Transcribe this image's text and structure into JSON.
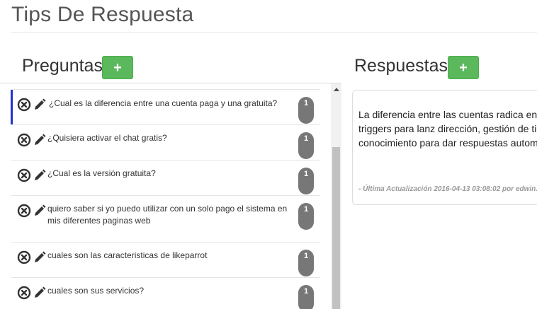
{
  "page": {
    "title": "Tips De Respuesta"
  },
  "questions": {
    "heading": "Preguntas",
    "add_label": "+",
    "items": [
      {
        "text": "¿Cual es la diferencia entre una cuenta paga y una gratuita?",
        "count": "1",
        "active": true
      },
      {
        "text": "¿Quisiera activar el chat gratis?",
        "count": "1",
        "active": false
      },
      {
        "text": "¿Cual es la versión gratuita?",
        "count": "1",
        "active": false
      },
      {
        "text": "quiero saber si yo puedo utilizar con un solo pago el sistema en mis diferentes paginas web",
        "count": "1",
        "active": false
      },
      {
        "text": "cuales son las caracteristicas de likeparrot",
        "count": "1",
        "active": false
      },
      {
        "text": "cuales son sus servicios?",
        "count": "1",
        "active": false
      }
    ]
  },
  "answers": {
    "heading": "Respuestas",
    "add_label": "+",
    "text": "La diferencia entre las cuentas radica en monitor de atenciones, triggers para lanz dirección, gestión de tickets, banco de co conocimiento para dar respuestas autom Genial ¿no?",
    "meta": "- Última Actualización 2016-04-13 03:08:02 por edwin."
  },
  "colors": {
    "accent_green": "#5cb85c",
    "badge_gray": "#777777",
    "active_marker": "#2233cc"
  },
  "icons": {
    "delete": "close-circle-icon",
    "edit": "pencil-icon"
  }
}
